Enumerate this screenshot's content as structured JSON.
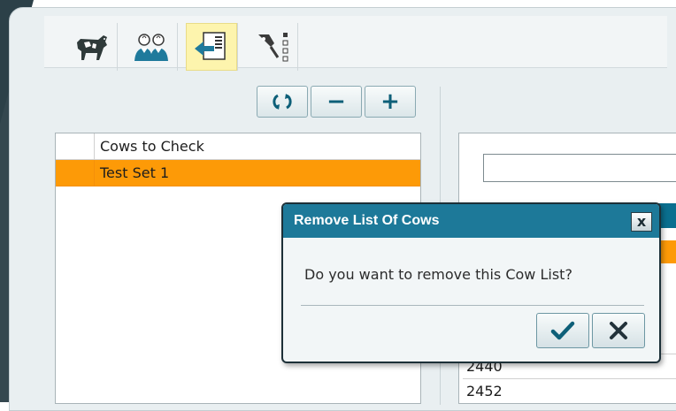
{
  "toolbar": {
    "items": [
      {
        "icon": "cow-icon",
        "active": false
      },
      {
        "icon": "people-icon",
        "active": false
      },
      {
        "icon": "import-list-icon",
        "active": true
      },
      {
        "icon": "tag-tool-icon",
        "active": false
      }
    ]
  },
  "list_buttons": {
    "refresh_icon": "refresh-icon",
    "remove_label": "−",
    "add_label": "+"
  },
  "cow_lists": {
    "items": [
      {
        "label": "Cows to Check",
        "selected": false
      },
      {
        "label": "Test Set 1",
        "selected": true
      }
    ]
  },
  "right_grid": {
    "rows": [
      "2440",
      "2452"
    ]
  },
  "dialog": {
    "title": "Remove List Of Cows",
    "close_label": "x",
    "message": "Do you want to remove this Cow List?",
    "confirm_icon": "checkmark-icon",
    "cancel_icon": "x-icon"
  },
  "colors": {
    "accent": "#1d7999",
    "selection": "#fd9a07",
    "active_tool": "#fdf4ad",
    "button_glyph": "#0d5f78"
  }
}
